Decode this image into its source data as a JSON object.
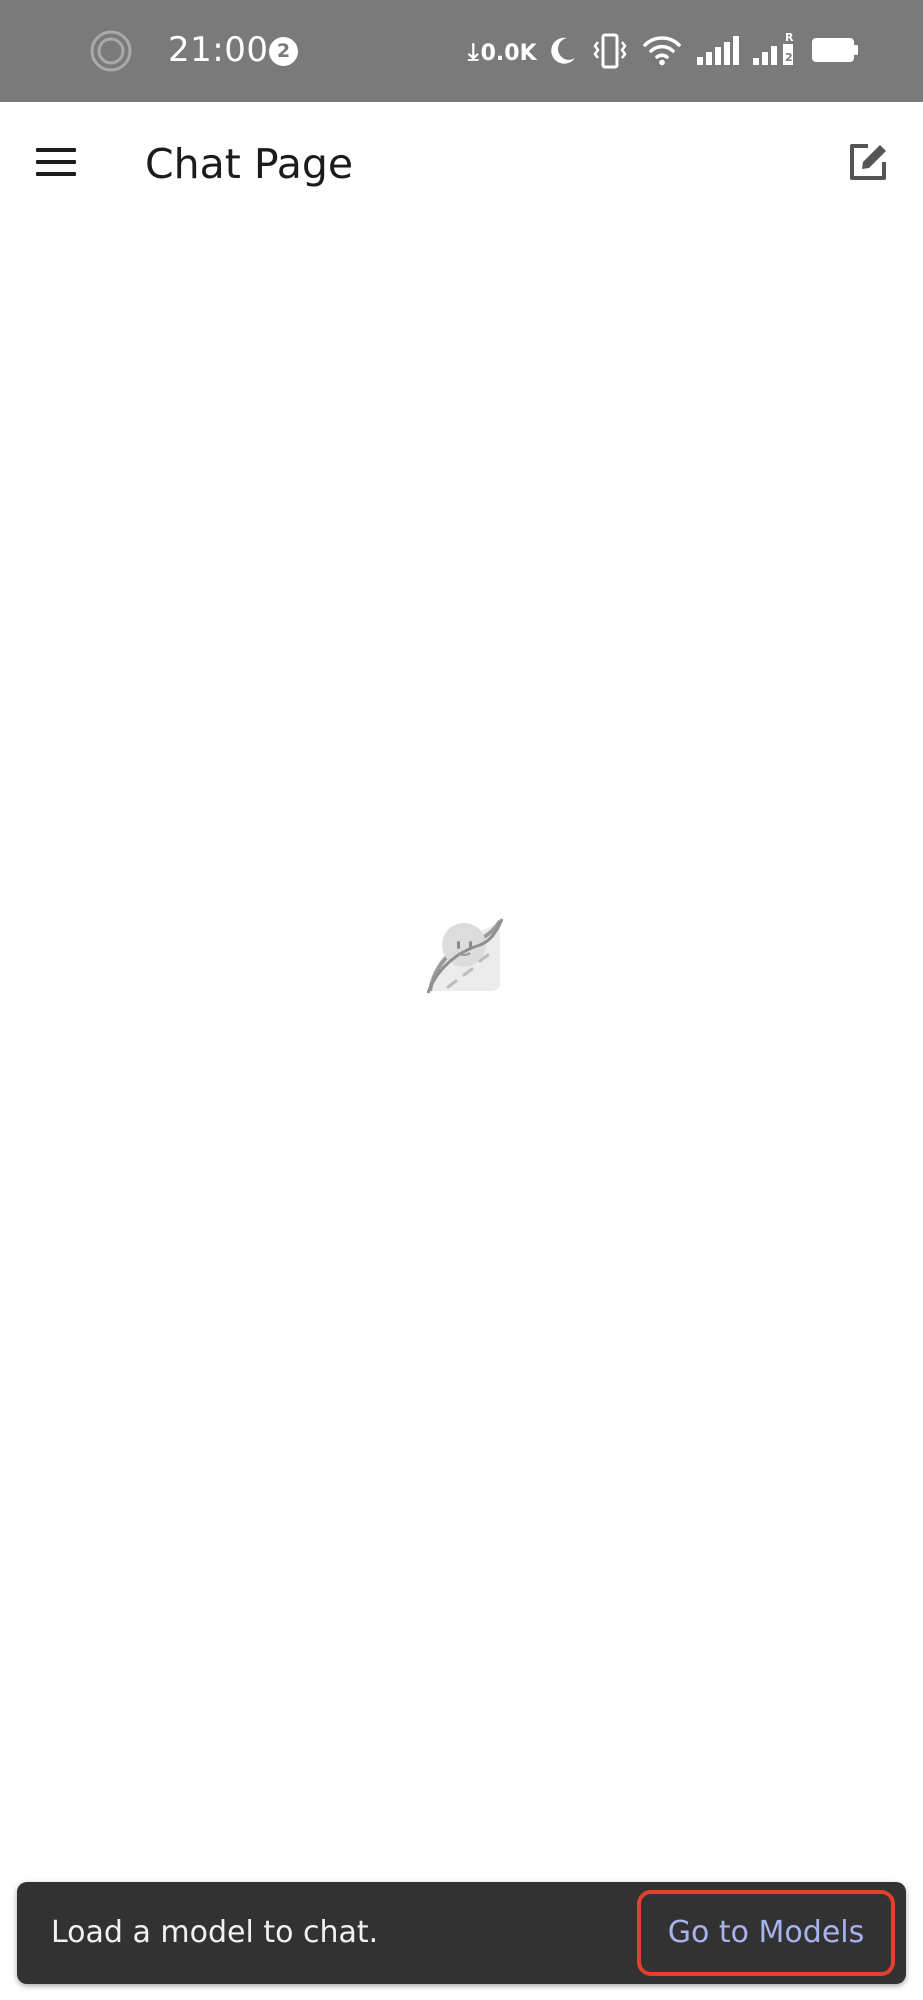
{
  "status_bar": {
    "time": "21:00",
    "notification_count": "2",
    "net_speed": "0.0K",
    "colors": {
      "background": "#7a7a7a",
      "foreground": "#ffffff"
    },
    "icons": [
      "screen-record-icon",
      "download-arrow-icon",
      "moon-icon",
      "vibrate-icon",
      "wifi-icon",
      "signal-icon",
      "signal-roaming-icon",
      "battery-icon"
    ]
  },
  "app_bar": {
    "title": "Chat Page",
    "left_icon": "menu-icon",
    "right_icon": "edit-icon"
  },
  "content": {
    "center_icon": "app-logo-icon"
  },
  "snackbar": {
    "message": "Load a model to chat.",
    "action_label": "Go to Models",
    "colors": {
      "background": "#323232",
      "text": "#f1f1f1",
      "action": "#a6b3ee",
      "highlight": "#e2402c"
    }
  }
}
